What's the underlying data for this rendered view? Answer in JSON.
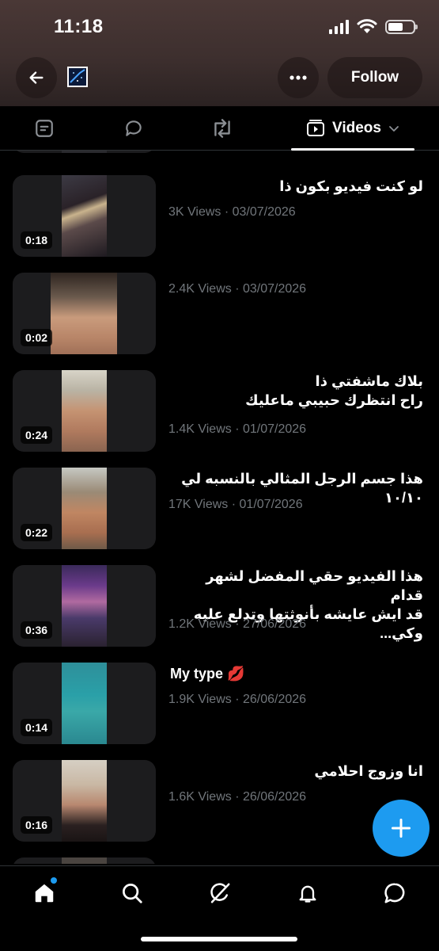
{
  "status_bar": {
    "time": "11:18"
  },
  "header": {
    "follow_label": "Follow",
    "back_icon": "arrow-left-icon",
    "more_icon": "more-horizontal-icon"
  },
  "tabs": {
    "active_label": "Videos",
    "icons": [
      "list-icon",
      "reply-icon",
      "repost-icon",
      "video-icon"
    ]
  },
  "videos": [
    {
      "title": "لو كنت فيديو بكون ذا",
      "meta": "3K Views · 03/07/2026",
      "duration": "0:18"
    },
    {
      "title": "",
      "meta": "2.4K Views · 03/07/2026",
      "duration": "0:02"
    },
    {
      "title": "بلاك ماشفتي ذا\nراح انتظرك حبيبي ماعليك",
      "meta": "1.4K Views · 01/07/2026",
      "duration": "0:24"
    },
    {
      "title": "هذا جسم الرجل المثالي بالنسبه لي ١٠/١٠",
      "meta": "17K Views · 01/07/2026",
      "duration": "0:22"
    },
    {
      "title": "هذا الفيديو حقي المفضل لشهر قدام\nقد ايش عايشه بأنوثتها وتدلع عليه وكي...",
      "meta": "1.2K Views · 27/06/2026",
      "duration": "0:36"
    },
    {
      "title": "My type 💋",
      "meta": "1.9K Views · 26/06/2026",
      "duration": "0:14"
    },
    {
      "title": "انا وزوج احلامي",
      "meta": "1.6K Views · 26/06/2026",
      "duration": "0:16"
    }
  ],
  "bottom_nav": [
    "home-icon",
    "search-icon",
    "grok-icon",
    "notifications-icon",
    "messages-icon"
  ],
  "colors": {
    "accent": "#1d9bf0",
    "background": "#000000",
    "muted_text": "#71767b"
  }
}
